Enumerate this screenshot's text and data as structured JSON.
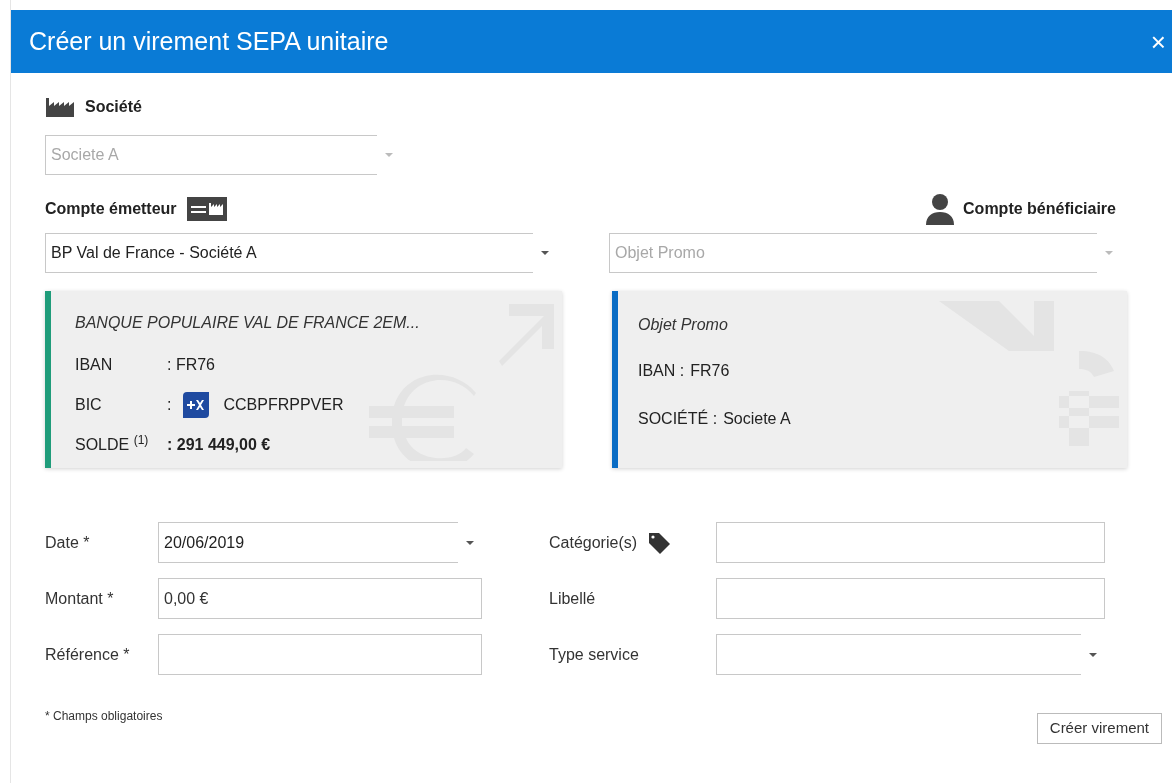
{
  "window": {
    "title": "Créer un virement SEPA unitaire",
    "close": "×"
  },
  "company": {
    "label": "Société",
    "select": {
      "value": "Societe A",
      "disabled": true
    }
  },
  "issuer": {
    "label": "Compte émetteur",
    "select": {
      "value": "BP Val de France - Société A",
      "disabled": false
    }
  },
  "beneficiary": {
    "label": "Compte bénéficiaire",
    "select": {
      "value": "Objet Promo",
      "disabled": true
    }
  },
  "issuer_card": {
    "color": "#1f9c7a",
    "title": "BANQUE POPULAIRE VAL DE FRANCE 2EM...",
    "rows": [
      {
        "label": "IBAN",
        "value": ": FR76",
        "logo": false,
        "emphasis": false
      },
      {
        "label": "BIC",
        "separator": ":",
        "value": "CCBPFRPPVER",
        "logo": true,
        "emphasis": false
      },
      {
        "label": "SOLDE $^{(1)}$",
        "value": ": 291 449,00 €",
        "logo": false,
        "emphasis": true
      }
    ]
  },
  "beneficiary_card": {
    "color": "#0a6cc4",
    "title": "Objet Promo",
    "rows": [
      {
        "label": "IBAN",
        "separator": ":",
        "value": "FR76"
      },
      {
        "label": "SOCIÉTÉ",
        "separator": ":",
        "value": "Societe A"
      }
    ]
  },
  "form_left": [
    {
      "label": "Date *",
      "kind": "select",
      "value": "20/06/2019"
    },
    {
      "label": "Montant *",
      "kind": "input",
      "value": "0,00 €"
    },
    {
      "label": "Référence *",
      "kind": "input"
    }
  ],
  "form_right": [
    {
      "label": "Catégorie(s)",
      "kind": "input",
      "tag": true
    },
    {
      "label": "Libellé",
      "kind": "input",
      "tag": false
    },
    {
      "label": "Type service",
      "kind": "select",
      "tag": false
    }
  ],
  "footnote": "* Champs obligatoires",
  "submit": "Créer virement"
}
